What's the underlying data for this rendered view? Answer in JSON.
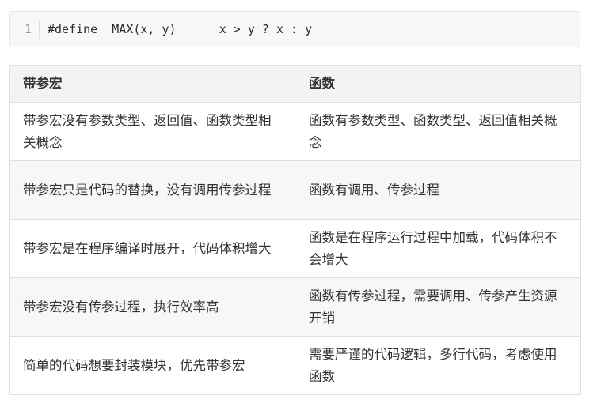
{
  "code": {
    "line_number": "1",
    "line": "#define  MAX(x, y)      x > y ? x : y"
  },
  "table": {
    "headers": [
      "带参宏",
      "函数"
    ],
    "rows": [
      [
        "带参宏没有参数类型、返回值、函数类型相关概念",
        "函数有参数类型、函数类型、返回值相关概念"
      ],
      [
        "带参宏只是代码的替换，没有调用传参过程",
        "函数有调用、传参过程"
      ],
      [
        "带参宏是在程序编译时展开，代码体积增大",
        "函数是在程序运行过程中加载，代码体积不会增大"
      ],
      [
        "带参宏没有传参过程，执行效率高",
        "函数有传参过程，需要调用、传参产生资源开销"
      ],
      [
        "简单的代码想要封装模块，优先带参宏",
        "需要严谨的代码逻辑，多行代码，考虑使用函数"
      ]
    ]
  }
}
